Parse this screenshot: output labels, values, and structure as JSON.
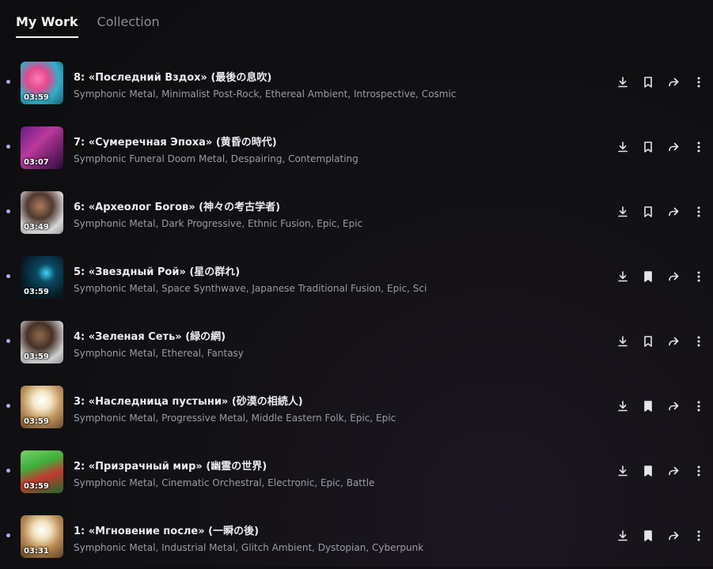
{
  "tabs": {
    "my_work": "My Work",
    "collection": "Collection"
  },
  "tracks": [
    {
      "title": "8: «Последний Вздох» (最後の息吹)",
      "tags": "Symphonic Metal, Minimalist Post-Rock, Ethereal Ambient, Introspective, Cosmic",
      "duration": "03:59",
      "bookmarked": false
    },
    {
      "title": "7: «Сумеречная Эпоха» (黄昏の時代)",
      "tags": "Symphonic Funeral Doom Metal, Despairing, Contemplating",
      "duration": "03:07",
      "bookmarked": false
    },
    {
      "title": "6: «Археолог Богов» (神々の考古学者)",
      "tags": "Symphonic Metal, Dark Progressive, Ethnic Fusion, Epic, Epic",
      "duration": "03:49",
      "bookmarked": false
    },
    {
      "title": "5: «Звездный Рой» (星の群れ)",
      "tags": "Symphonic Metal, Space Synthwave, Japanese Traditional Fusion, Epic, Sci",
      "duration": "03:59",
      "bookmarked": true
    },
    {
      "title": "4: «Зеленая Сеть» (緑の網)",
      "tags": "Symphonic Metal, Ethereal, Fantasy",
      "duration": "03:59",
      "bookmarked": false
    },
    {
      "title": "3: «Наследница пустыни» (砂漠の相続人)",
      "tags": "Symphonic Metal, Progressive Metal, Middle Eastern Folk, Epic, Epic",
      "duration": "03:59",
      "bookmarked": true
    },
    {
      "title": "2: «Призрачный мир» (幽霊の世界)",
      "tags": "Symphonic Metal, Cinematic Orchestral, Electronic, Epic, Battle",
      "duration": "03:59",
      "bookmarked": true
    },
    {
      "title": "1: «Мгновение после» (一瞬の後)",
      "tags": "Symphonic Metal, Industrial Metal, Glitch Ambient, Dystopian, Cyberpunk",
      "duration": "03:31",
      "bookmarked": true
    }
  ],
  "icons": {
    "download": "download-icon",
    "bookmark": "bookmark-icon",
    "share": "share-icon",
    "more": "more-icon"
  },
  "colors": {
    "accent": "#b8a8f0",
    "background": "#0d0d0f",
    "text": "#ececf0",
    "muted": "#9b9ba3"
  }
}
